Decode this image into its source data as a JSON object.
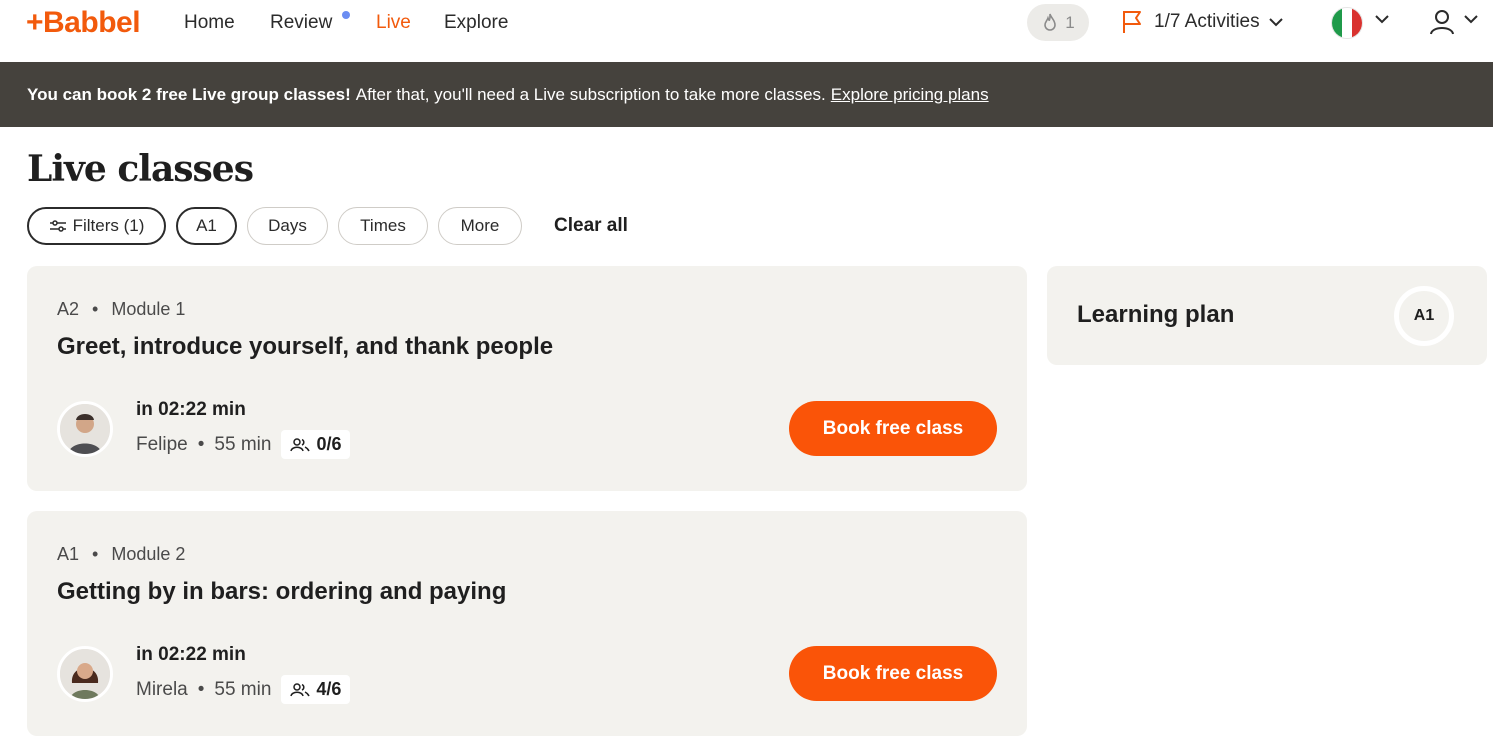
{
  "nav": {
    "logo": "+Babbel",
    "links": [
      {
        "label": "Home",
        "active": false
      },
      {
        "label": "Review",
        "active": false,
        "has_dot": true
      },
      {
        "label": "Live",
        "active": true
      },
      {
        "label": "Explore",
        "active": false
      }
    ],
    "streak_count": "1",
    "activities_label": "1/7 Activities",
    "language_flag": "italy-flag-icon",
    "user_icon": "user-icon"
  },
  "banner": {
    "bold": "You can book 2 free Live group classes!",
    "text": "After that, you'll need a Live subscription to take more classes.",
    "link": "Explore pricing plans"
  },
  "page": {
    "title": "Live classes"
  },
  "filters": {
    "chips": [
      "Filters (1)",
      "A1",
      "Days",
      "Times",
      "More"
    ],
    "clear_all": "Clear all"
  },
  "classes": [
    {
      "level": "A2",
      "module": "Module 1",
      "title": "Greet, introduce yourself, and thank people",
      "starts_in": "in 02:22 min",
      "teacher": "Felipe",
      "duration": "55 min",
      "seats": "0/6",
      "button": "Book free class"
    },
    {
      "level": "A1",
      "module": "Module 2",
      "title": "Getting by in bars: ordering and paying",
      "starts_in": "in 02:22 min",
      "teacher": "Mirela",
      "duration": "55 min",
      "seats": "4/6",
      "button": "Book free class"
    }
  ],
  "learning_plan": {
    "title": "Learning plan",
    "level": "A1"
  },
  "colors": {
    "accent": "#f25a0c",
    "button": "#fa5408",
    "banner": "#45423d",
    "card": "#f3f2ee",
    "review_dot": "#6b8df2"
  }
}
